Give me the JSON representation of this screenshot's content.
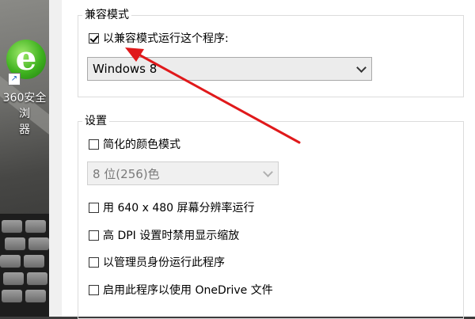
{
  "desktop": {
    "app_icon": "ie-browser-icon",
    "app_label_line1": "360安全浏",
    "app_label_line2": "器"
  },
  "compat_group": {
    "title": "兼容模式",
    "checkbox_label": "以兼容模式运行这个程序:",
    "checked": true,
    "select_value": "Windows 8"
  },
  "settings_group": {
    "title": "设置",
    "reduced_color_label": "简化的颜色模式",
    "color_select_value": "8 位(256)色",
    "resolution_label": "用 640 x 480 屏幕分辨率运行",
    "dpi_label": "高 DPI 设置时禁用显示缩放",
    "admin_label": "以管理员身份运行此程序",
    "onedrive_label": "启用此程序以使用 OneDrive 文件"
  },
  "annotation": {
    "arrow_color": "#e0191b"
  }
}
